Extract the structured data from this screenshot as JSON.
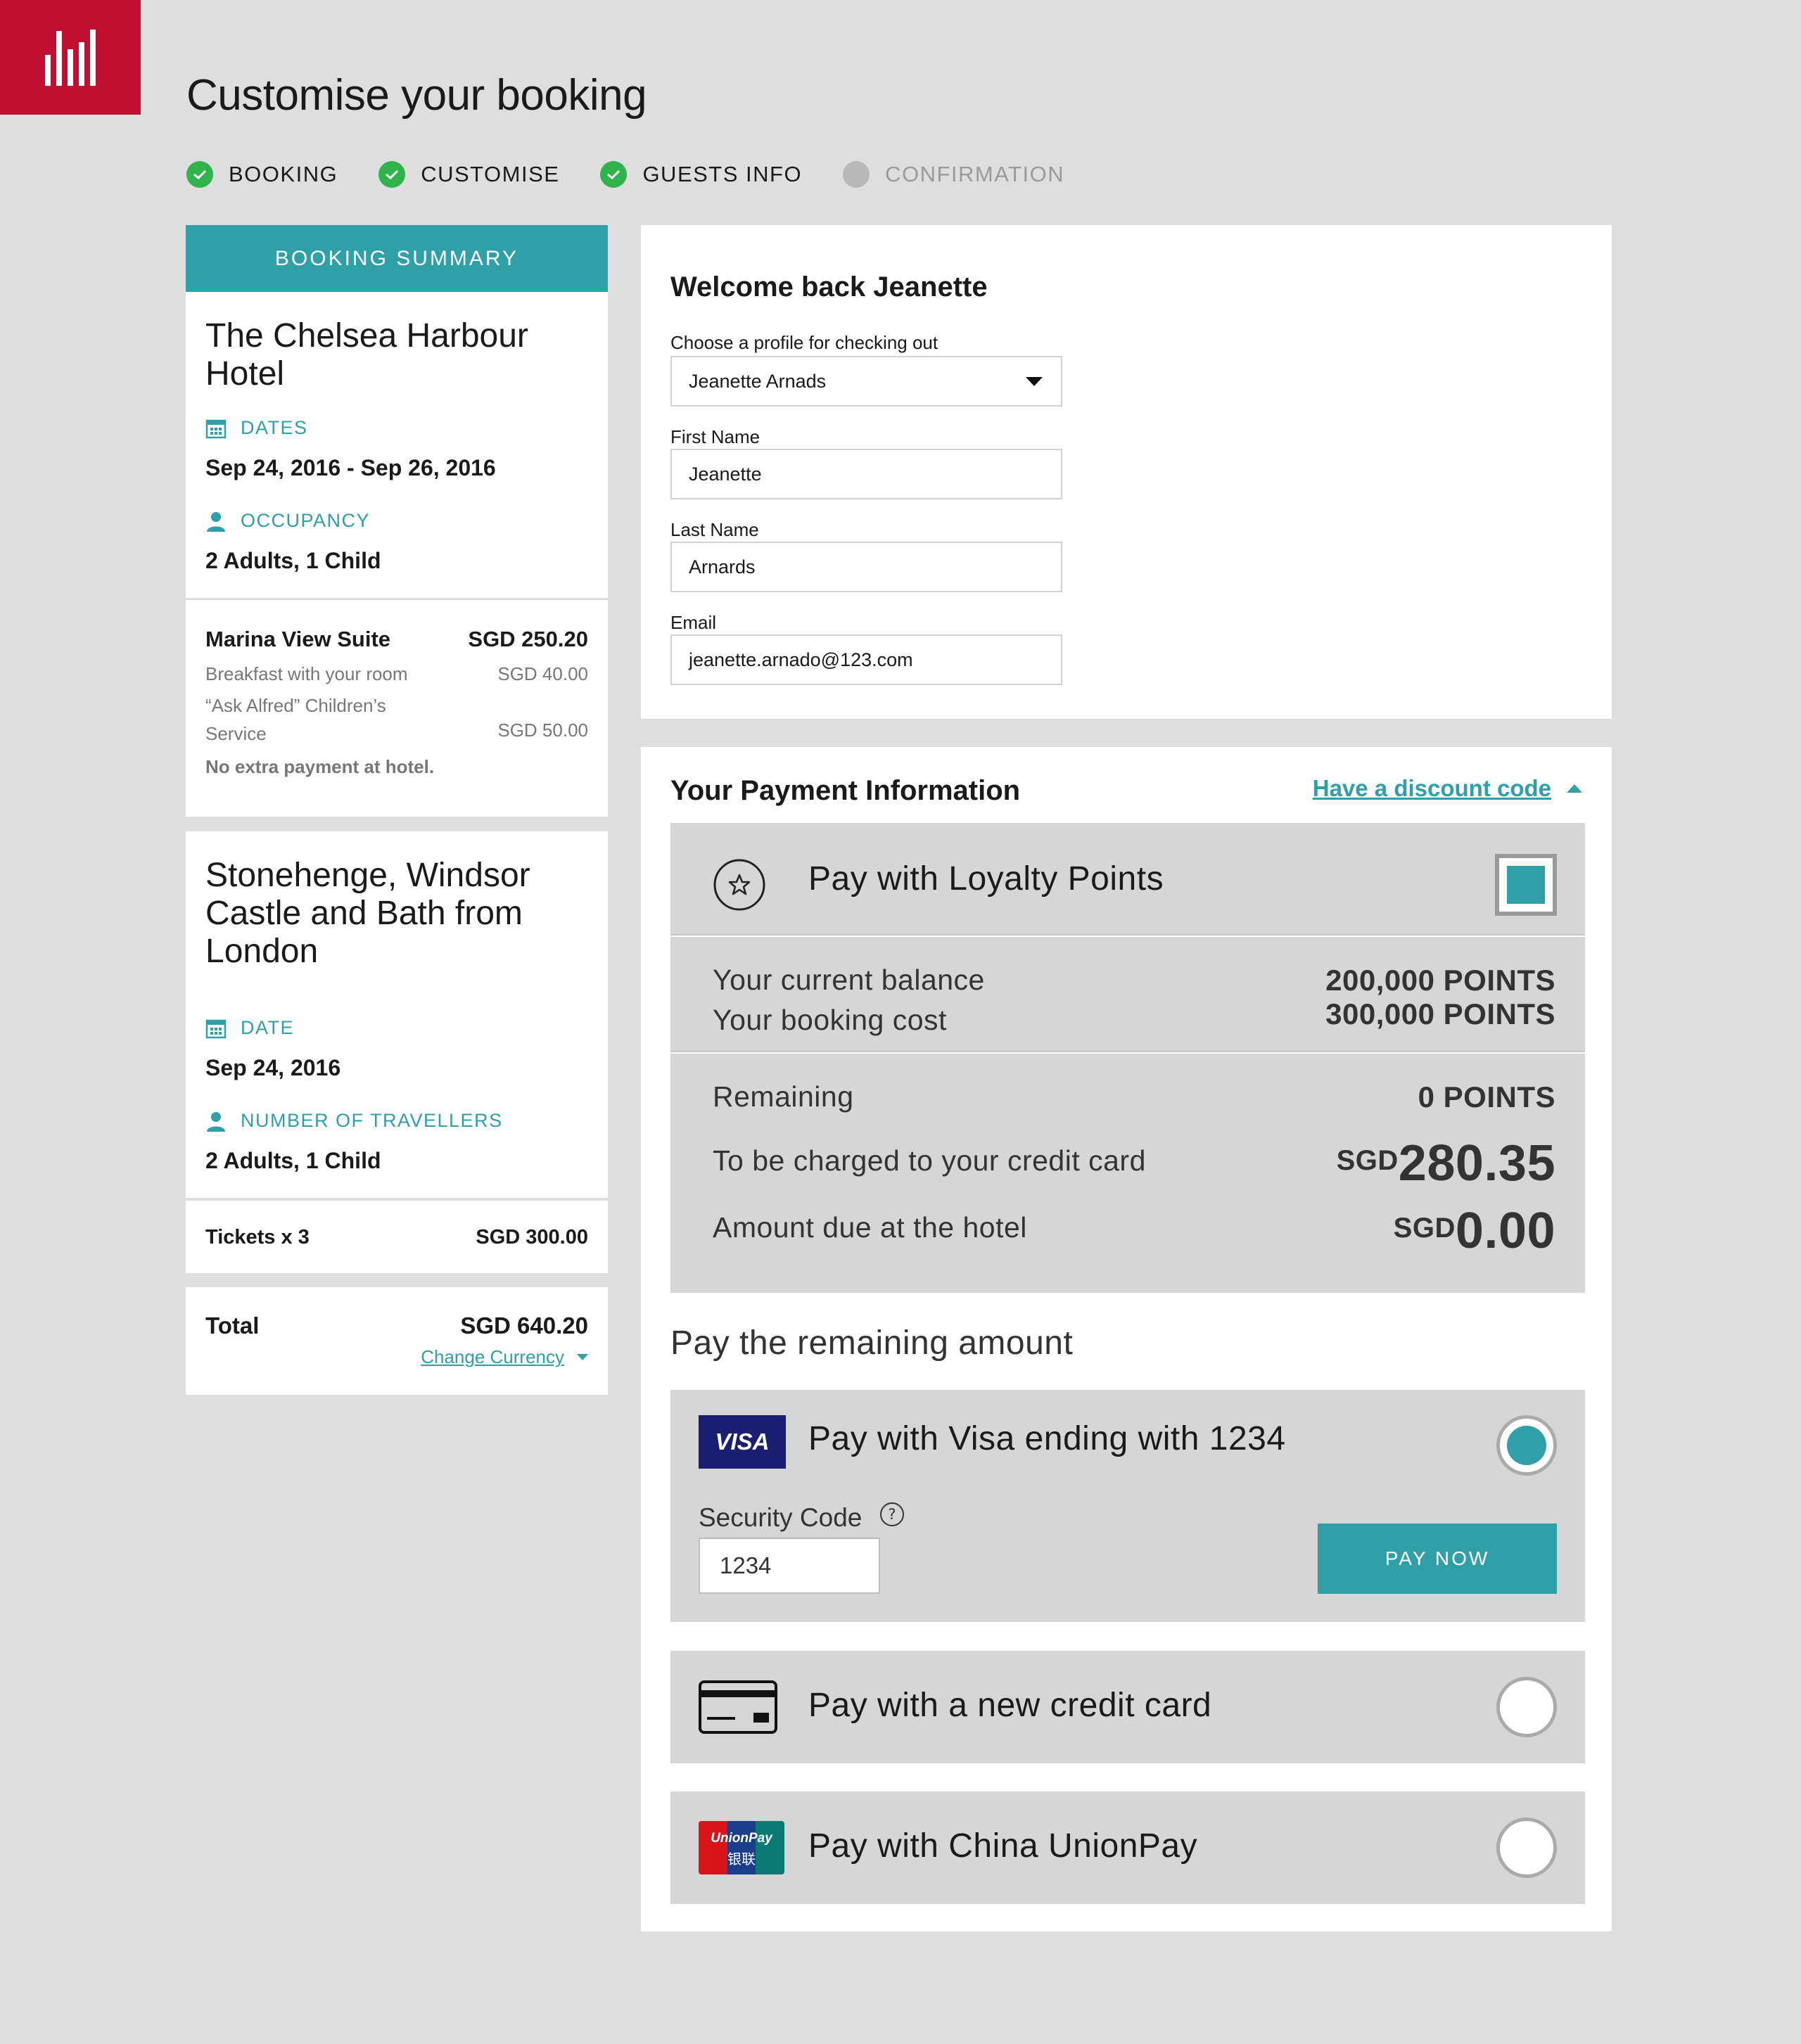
{
  "page_title": "Customise your booking",
  "steps": [
    {
      "label": "BOOKING",
      "status": "done"
    },
    {
      "label": "CUSTOMISE",
      "status": "done"
    },
    {
      "label": "GUESTS INFO",
      "status": "done"
    },
    {
      "label": "CONFIRMATION",
      "status": "pending"
    }
  ],
  "summary": {
    "header": "BOOKING SUMMARY",
    "hotel": {
      "name_line1": "The Chelsea Harbour",
      "name_line2": "Hotel",
      "dates_label": "DATES",
      "dates_value": "Sep 24, 2016 - Sep 26, 2016",
      "occupancy_label": "OCCUPANCY",
      "occupancy_value": "2 Adults, 1 Child",
      "room_name": "Marina View Suite",
      "room_price": "SGD 250.20",
      "extra1_name": "Breakfast with your room",
      "extra1_price": "SGD 40.00",
      "extra2_name_line1": "“Ask Alfred” Children’s",
      "extra2_name_line2": "Service",
      "extra2_price": "SGD 50.00",
      "note": "No extra payment at hotel."
    },
    "tour": {
      "name_line1": "Stonehenge, Windsor",
      "name_line2": "Castle and Bath from",
      "name_line3": "London",
      "date_label": "DATE",
      "date_value": "Sep 24, 2016",
      "travellers_label": "NUMBER OF TRAVELLERS",
      "travellers_value": "2 Adults, 1 Child",
      "tickets_label": "Tickets x 3",
      "tickets_price": "SGD 300.00"
    },
    "total_label": "Total",
    "total_value": "SGD 640.20",
    "change_currency": "Change Currency"
  },
  "profile": {
    "welcome": "Welcome back Jeanette",
    "choose_label": "Choose a profile for checking out",
    "profile_value": "Jeanette Arnads",
    "first_name_label": "First Name",
    "first_name_value": "Jeanette",
    "last_name_label": "Last Name",
    "last_name_value": "Arnards",
    "email_label": "Email",
    "email_value": "jeanette.arnado@123.com"
  },
  "payment": {
    "title": "Your Payment Information",
    "discount_link": "Have a discount code",
    "loyalty_label": "Pay with Loyalty Points",
    "loyalty_checked": true,
    "balance_label": "Your current balance",
    "balance_value": "200,000 POINTS",
    "cost_label": "Your booking cost",
    "cost_value": "300,000 POINTS",
    "remaining_label": "Remaining",
    "remaining_value": "0 POINTS",
    "charge_label": "To be charged to your credit card",
    "charge_currency": "SGD",
    "charge_amount": "280.35",
    "hotel_due_label": "Amount due at the hotel",
    "hotel_due_currency": "SGD",
    "hotel_due_amount": "0.00",
    "remaining_heading": "Pay the remaining amount",
    "visa_badge": "VISA",
    "visa_label": "Pay with Visa ending with 1234",
    "security_label": "Security Code",
    "security_value": "1234",
    "pay_now": "PAY NOW",
    "new_card_label": "Pay with a new credit card",
    "unionpay_badge_top": "UnionPay",
    "unionpay_badge_bottom": "银联",
    "unionpay_label": "Pay with China UnionPay",
    "selected_method": "visa"
  },
  "colors": {
    "brand_red": "#c0102f",
    "teal": "#2f9fa8",
    "success_green": "#2fb34a",
    "visa_navy": "#1a1f71"
  }
}
